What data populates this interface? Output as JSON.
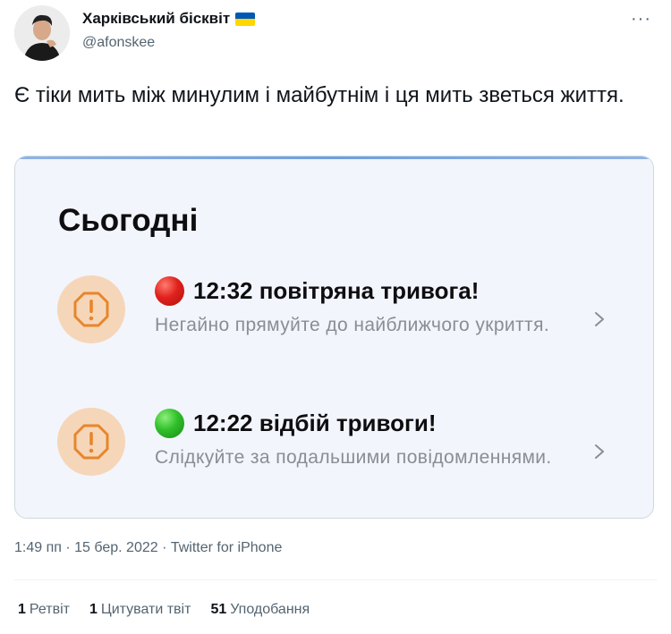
{
  "user": {
    "display_name": "Харківський бісквіт",
    "handle": "@afonskee",
    "flag_icon": "ukraine-flag-icon"
  },
  "menu": {
    "more_label": "···"
  },
  "tweet": {
    "text": "Є тіки мить між минулим і майбутнім і ця мить зветься життя."
  },
  "card": {
    "title": "Сьогодні",
    "alerts": [
      {
        "status_color": "#e0211c",
        "title": "12:32 повітряна тривога!",
        "description": "Негайно прямуйте до найближчого укриття."
      },
      {
        "status_color": "#2fbf2a",
        "title": "12:22 відбій тривоги!",
        "description": "Слідкуйте за подальшими повідомленнями."
      }
    ]
  },
  "meta": {
    "time": "1:49 пп",
    "date": "15 бер. 2022",
    "source": "Twitter for iPhone",
    "line": "1:49 пп · 15 бер. 2022 · Twitter for iPhone"
  },
  "stats": {
    "retweets_count": "1",
    "retweets_label": "Ретвіт",
    "quotes_count": "1",
    "quotes_label": "Цитувати твіт",
    "likes_count": "51",
    "likes_label": "Уподобання"
  },
  "colors": {
    "warning_bg": "#f6d6b9",
    "warning_stroke": "#e8862a",
    "card_bg": "#f2f5fb",
    "secondary_text": "#536471"
  }
}
